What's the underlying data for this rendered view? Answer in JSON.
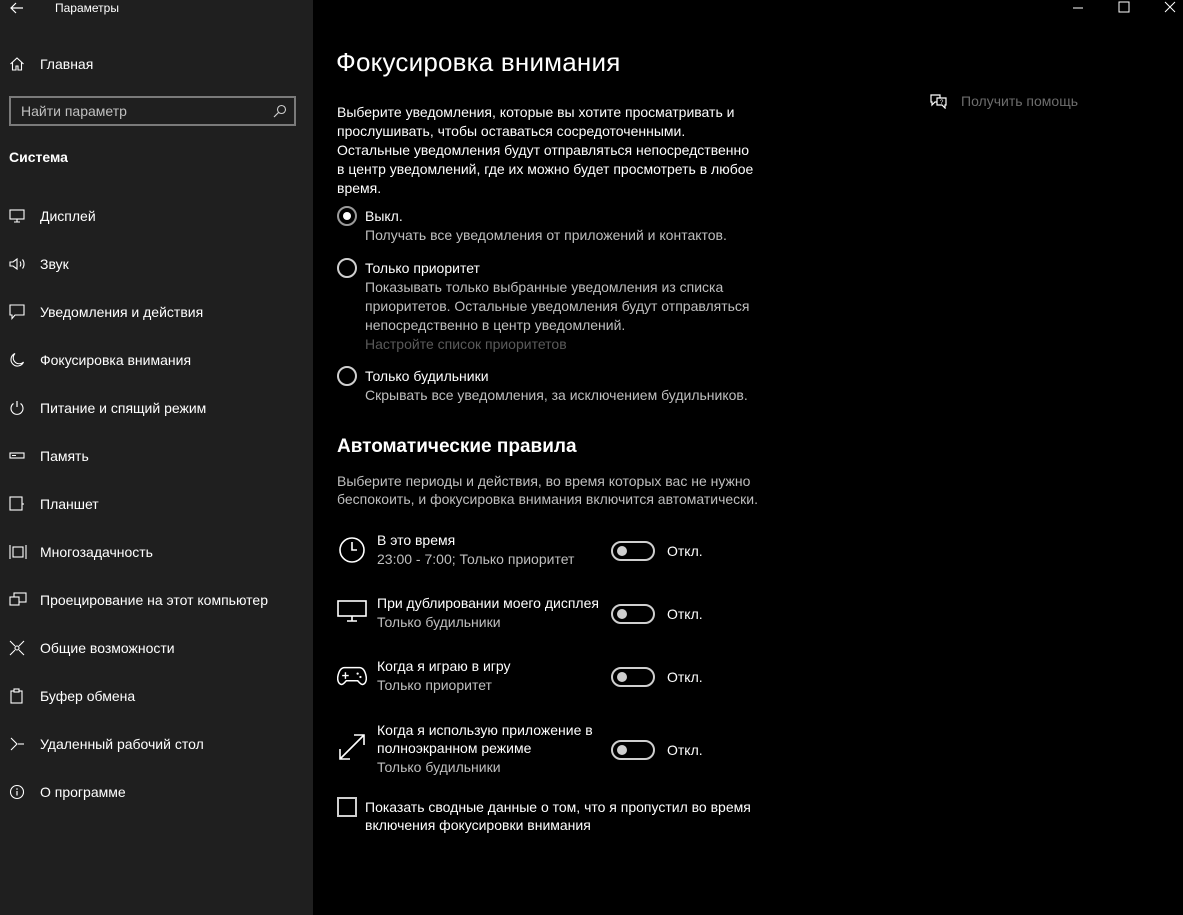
{
  "window": {
    "app_title": "Параметры",
    "controls": [
      "minimize-icon",
      "maximize-icon",
      "close-icon"
    ]
  },
  "sidebar": {
    "home_label": "Главная",
    "search_placeholder": "Найти параметр",
    "section_title": "Система",
    "items": [
      {
        "label": "Дисплей",
        "icon": "display-icon"
      },
      {
        "label": "Звук",
        "icon": "speaker-icon"
      },
      {
        "label": "Уведомления и действия",
        "icon": "notification-icon"
      },
      {
        "label": "Фокусировка внимания",
        "icon": "moon-icon",
        "active": true
      },
      {
        "label": "Питание и спящий режим",
        "icon": "power-icon"
      },
      {
        "label": "Память",
        "icon": "storage-icon"
      },
      {
        "label": "Планшет",
        "icon": "tablet-icon"
      },
      {
        "label": "Многозадачность",
        "icon": "multitasking-icon"
      },
      {
        "label": "Проецирование на этот компьютер",
        "icon": "projection-icon"
      },
      {
        "label": "Общие возможности",
        "icon": "shared-experiences-icon"
      },
      {
        "label": "Буфер обмена",
        "icon": "clipboard-icon"
      },
      {
        "label": "Удаленный рабочий стол",
        "icon": "remote-desktop-icon"
      },
      {
        "label": "О программе",
        "icon": "info-icon"
      }
    ]
  },
  "main": {
    "title": "Фокусировка внимания",
    "intro": "Выберите уведомления, которые вы хотите просматривать и прослушивать, чтобы оставаться сосредоточенными. Остальные уведомления будут отправляться непосредственно в центр уведомлений, где их можно будет просмотреть в любое время.",
    "help_label": "Получить помощь",
    "options": [
      {
        "title": "Выкл.",
        "desc": "Получать все уведомления от приложений и контактов.",
        "checked": true
      },
      {
        "title": "Только приоритет",
        "desc": "Показывать только выбранные уведомления из списка приоритетов. Остальные уведомления будут отправляться непосредственно в центр уведомлений.",
        "link": "Настройте список приоритетов",
        "checked": false
      },
      {
        "title": "Только будильники",
        "desc": "Скрывать все уведомления, за исключением будильников.",
        "checked": false
      }
    ],
    "rules_title": "Автоматические правила",
    "rules_desc": "Выберите периоды и действия, во время которых вас не нужно беспокоить, и фокусировка внимания включится автоматически.",
    "rules": [
      {
        "title": "В это время",
        "sub": "23:00 - 7:00; Только приоритет",
        "state": "Откл.",
        "icon": "clock-icon"
      },
      {
        "title": "При дублировании моего дисплея",
        "sub": "Только будильники",
        "state": "Откл.",
        "icon": "monitor-icon"
      },
      {
        "title": "Когда я играю в игру",
        "sub": "Только приоритет",
        "state": "Откл.",
        "icon": "gamepad-icon"
      },
      {
        "title": "Когда я использую приложение в полноэкранном режиме",
        "sub": "Только будильники",
        "state": "Откл.",
        "icon": "fullscreen-icon"
      }
    ],
    "summary_label": "Показать сводные данные о том, что я пропустил во время включения фокусировки внимания",
    "summary_checked": false
  }
}
